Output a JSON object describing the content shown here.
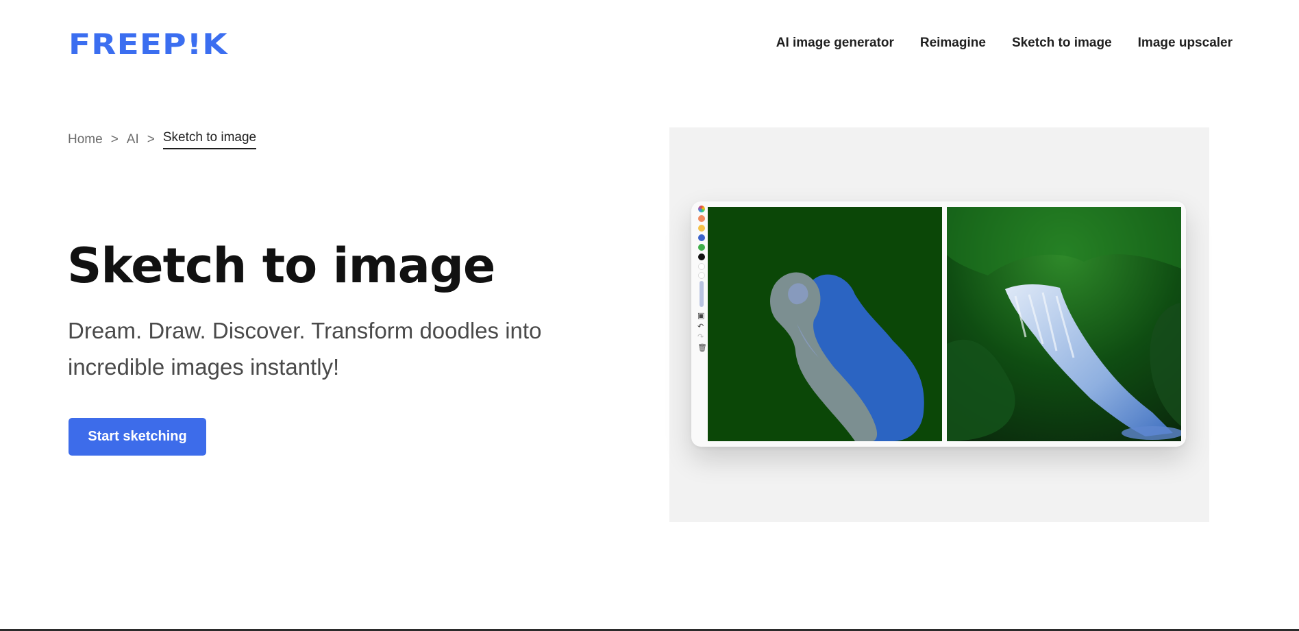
{
  "brand": {
    "logo_text": "FREEP!K",
    "accent_color": "#3d6cea"
  },
  "nav": {
    "items": [
      {
        "label": "AI image generator"
      },
      {
        "label": "Reimagine"
      },
      {
        "label": "Sketch to image"
      },
      {
        "label": "Image upscaler"
      }
    ]
  },
  "breadcrumb": {
    "items": [
      {
        "label": "Home"
      },
      {
        "label": "AI"
      },
      {
        "label": "Sketch to image"
      }
    ],
    "separator": ">"
  },
  "hero": {
    "title": "Sketch to image",
    "subtitle": "Dream. Draw. Discover. Transform doodles into incredible images instantly!",
    "cta_label": "Start sketching"
  },
  "preview": {
    "palette_colors": [
      "#f08a5d",
      "#f5c247",
      "#3b63c9",
      "#3fae4a",
      "#111111",
      "#ffffff",
      "#ffffff"
    ],
    "tool_icons": [
      "image-icon",
      "undo-icon",
      "redo-icon",
      "trash-icon"
    ]
  }
}
